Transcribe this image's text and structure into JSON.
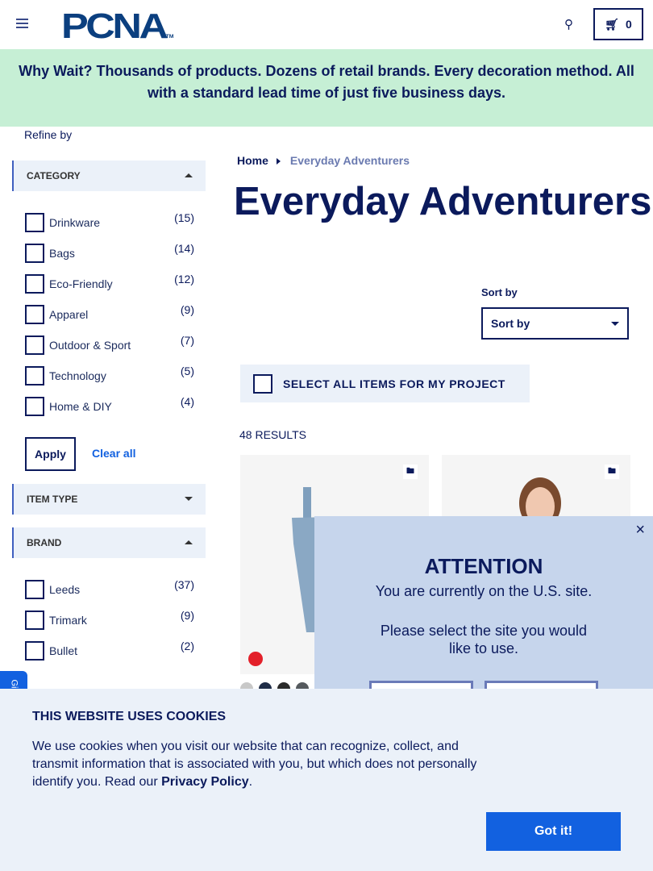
{
  "header": {
    "logo": "PCNA",
    "logo_tm": "TM",
    "cart_count": "0"
  },
  "banner": "Why Wait? Thousands of products. Dozens of retail brands. Every decoration method. All with a standard lead time of just five business days.",
  "sidebar": {
    "refine": "Refine by",
    "category": {
      "title": "CATEGORY",
      "options": [
        {
          "label": "Drinkware",
          "count": "(15)"
        },
        {
          "label": "Bags",
          "count": "(14)"
        },
        {
          "label": "Eco-Friendly",
          "count": "(12)"
        },
        {
          "label": "Apparel",
          "count": "(9)"
        },
        {
          "label": "Outdoor & Sport",
          "count": "(7)"
        },
        {
          "label": "Technology",
          "count": "(5)"
        },
        {
          "label": "Home & DIY",
          "count": "(4)"
        }
      ]
    },
    "apply": "Apply",
    "clear": "Clear all",
    "item_type": {
      "title": "ITEM TYPE"
    },
    "brand": {
      "title": "BRAND",
      "options": [
        {
          "label": "Leeds",
          "count": "(37)"
        },
        {
          "label": "Trimark",
          "count": "(9)"
        },
        {
          "label": "Bullet",
          "count": "(2)"
        }
      ]
    }
  },
  "breadcrumb": {
    "home": "Home",
    "current": "Everyday Adventurers"
  },
  "title": "Everyday Adventurers",
  "sort": {
    "label": "Sort by",
    "value": "Sort by"
  },
  "select_all": "SELECT ALL ITEMS FOR MY PROJECT",
  "results": "48 RESULTS",
  "swatch_colors": [
    "#c8c8c8",
    "#1f2d48",
    "#2b2b2b",
    "#555a5e"
  ],
  "modal": {
    "title": "ATTENTION",
    "line1": "You are currently on the U.S. site.",
    "line2": "Please select the site you would like to use.",
    "close": "×"
  },
  "side_tab": "Gi",
  "cookie": {
    "title": "THIS WEBSITE USES COOKIES",
    "text": "We use cookies when you visit our website that can recognize, collect, and transmit information that is associated with you, but which does not personally identify you. Read our ",
    "link": "Privacy Policy",
    "end": ".",
    "button": "Got it!"
  }
}
